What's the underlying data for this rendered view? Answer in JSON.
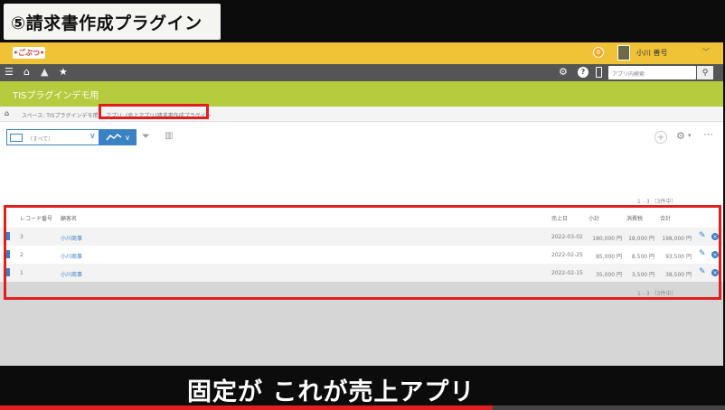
{
  "video": {
    "title_banner": "⑤請求書作成プラグイン",
    "caption": "固定が これが売上アプリ",
    "progress": 0.68
  },
  "colors": {
    "topbar": "#f0c236",
    "navbar": "#555555",
    "app_header": "#b6cc3e",
    "accent": "#3b82c4",
    "highlight": "#e02020"
  },
  "topbar": {
    "logo_text": "•ごぶつ•",
    "notification_badge": "8",
    "user_name": "小川 善号",
    "user_caret": "﹀"
  },
  "navbar": {
    "menu_icon": "☰",
    "home_icon": "⌂",
    "star_icon": "★",
    "settings_icon": "⚙",
    "help_icon": "?",
    "search_placeholder": "アプリ内検索",
    "search_icon": "⚲"
  },
  "app_header": {
    "title": "TISプラグインデモ用"
  },
  "breadcrumb": {
    "home_icon": "⌂",
    "space": "スペース: TISプラグインデモ用",
    "separator": "›",
    "app": "アプリ: (売上アプリ)請求書作成プラグイン"
  },
  "toolbar": {
    "view_label": "（すべて）",
    "view_caret": "∨",
    "graph_icon": "⌇",
    "graph_caret": "∨",
    "filter_icon": "⏷",
    "chart_icon": "▥",
    "add_icon": "+",
    "gear_icon": "⚙",
    "gear_caret": "▾",
    "more_icon": "⋯"
  },
  "pager_top": "1 - 3 （3件中）",
  "pager_bottom": "1 - 3 （3件中）",
  "table": {
    "columns": [
      "レコード番号",
      "顧客名",
      "売上日",
      "小計",
      "消費税",
      "合計"
    ],
    "rows": [
      {
        "record_no": "3",
        "customer": "小川商事",
        "date": "2022-03-02",
        "subtotal": "180,000 円",
        "tax": "18,000 円",
        "total": "198,000 円"
      },
      {
        "record_no": "2",
        "customer": "小川商事",
        "date": "2022-02-25",
        "subtotal": "85,000 円",
        "tax": "8,500 円",
        "total": "93,500 円"
      },
      {
        "record_no": "1",
        "customer": "小川商事",
        "date": "2022-02-15",
        "subtotal": "35,000 円",
        "tax": "3,500 円",
        "total": "38,500 円"
      }
    ],
    "edit_icon": "✎",
    "delete_icon": "×"
  }
}
